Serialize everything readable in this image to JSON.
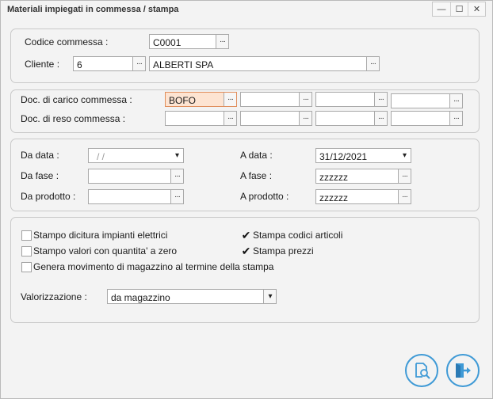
{
  "window": {
    "title": "Materiali impiegati in commessa / stampa",
    "controls": {
      "minimize": "—",
      "maximize": "☐",
      "close": "✕"
    }
  },
  "commessa": {
    "codice_label": "Codice commessa :",
    "codice_value": "C0001",
    "cliente_label": "Cliente :",
    "cliente_code": "6",
    "cliente_name": "ALBERTI SPA"
  },
  "documenti": {
    "carico_label": "Doc. di carico commessa :",
    "reso_label": "Doc. di reso commessa :",
    "carico_values": [
      "BOFO",
      "",
      "",
      ""
    ],
    "reso_values": [
      "",
      "",
      "",
      ""
    ]
  },
  "filtri": {
    "da_data_label": "Da data :",
    "da_data_value": "/ /",
    "a_data_label": "A data :",
    "a_data_value": "31/12/2021",
    "da_fase_label": "Da fase :",
    "da_fase_value": "",
    "a_fase_label": "A fase :",
    "a_fase_value": "zzzzzz",
    "da_prodotto_label": "Da prodotto :",
    "da_prodotto_value": "",
    "a_prodotto_label": "A prodotto :",
    "a_prodotto_value": "zzzzzz"
  },
  "opzioni": {
    "stampo_dicitura": "Stampo dicitura impianti elettrici",
    "stampo_valori": "Stampo valori con quantita' a zero",
    "genera_movimento": "Genera movimento di magazzino al termine della stampa",
    "stampa_codici": "Stampa codici articoli",
    "stampa_prezzi": "Stampa prezzi",
    "checked_mark": "✔",
    "valorizzazione_label": "Valorizzazione :",
    "valorizzazione_value": "da magazzino"
  },
  "buttons": {
    "dots": "···",
    "dropdown": "▾"
  },
  "colors": {
    "accent": "#3f9ad6",
    "active_field": "#fde4d2"
  }
}
